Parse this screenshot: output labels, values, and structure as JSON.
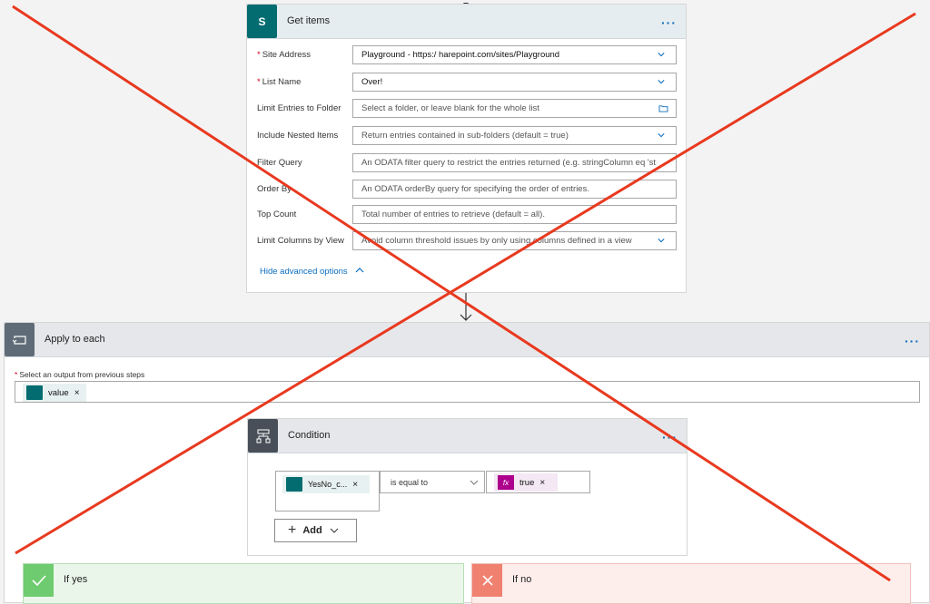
{
  "get_items": {
    "title": "Get items",
    "more": "···",
    "fields": [
      {
        "label": "Site Address",
        "required": "*",
        "value": "Playground - https:/                    harepoint.com/sites/Playground"
      },
      {
        "label": "List Name",
        "required": "*",
        "value": "Over!"
      },
      {
        "label": "Limit Entries to Folder",
        "placeholder": "Select a folder, or leave blank for the whole list"
      },
      {
        "label": "Include Nested Items",
        "placeholder": "Return entries contained in sub-folders (default = true)"
      },
      {
        "label": "Filter Query",
        "placeholder": "An ODATA filter query to restrict the entries returned (e.g. stringColumn eq 'st"
      },
      {
        "label": "Order By",
        "placeholder": "An ODATA orderBy query for specifying the order of entries."
      },
      {
        "label": "Top Count",
        "placeholder": "Total number of entries to retrieve (default = all)."
      },
      {
        "label": "Limit Columns by View",
        "placeholder": "Avoid column threshold issues by only using columns defined in a view"
      }
    ],
    "hide_advanced": "Hide advanced options"
  },
  "apply_each": {
    "title": "Apply to each",
    "more": "···",
    "select_label": "Select an output from previous steps",
    "required": "*",
    "token": "value",
    "token_x": "×"
  },
  "condition": {
    "title": "Condition",
    "more": "···",
    "left_token": "YesNo_c...",
    "operator": "is equal to",
    "right_token": "true",
    "fx": "fx",
    "token_x": "×",
    "add_plus": "+",
    "add_label": "Add"
  },
  "if_yes": {
    "label": "If yes"
  },
  "if_no": {
    "label": "If no"
  },
  "colors": {
    "sharepoint": "#036c70",
    "link": "#0a6cbf",
    "cross": "#e8391f",
    "yes": "#6fcb6f",
    "no": "#f08070"
  }
}
